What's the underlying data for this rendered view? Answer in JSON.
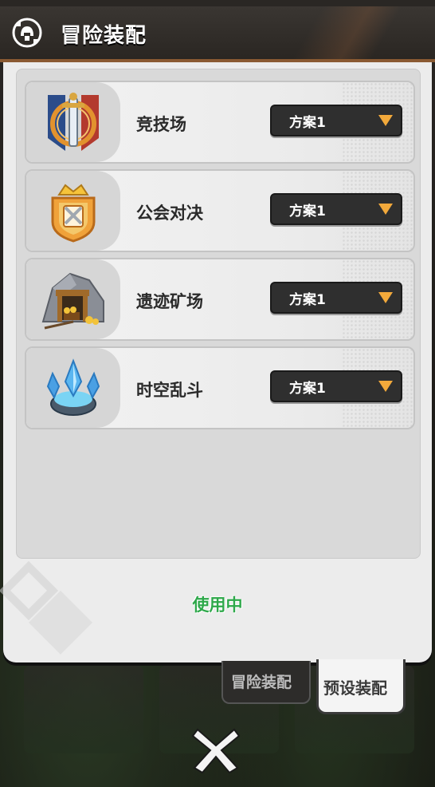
{
  "header": {
    "title": "冒险装配",
    "icon": "helmet-swap-icon"
  },
  "rows": [
    {
      "label": "竞技场",
      "dropdown": "方案1",
      "icon": "arena-sword-shield-icon"
    },
    {
      "label": "公会对决",
      "dropdown": "方案1",
      "icon": "guild-crown-badge-icon"
    },
    {
      "label": "遗迹矿场",
      "dropdown": "方案1",
      "icon": "mine-cave-gold-icon"
    },
    {
      "label": "时空乱斗",
      "dropdown": "方案1",
      "icon": "crystal-portal-icon"
    }
  ],
  "status": "使用中",
  "tabs": {
    "adventure": "冒险装配",
    "preset": "预设装配",
    "active": "preset"
  },
  "close": {
    "icon": "close-x-icon"
  },
  "colors": {
    "accent": "#f2a93b",
    "status": "#2ea84a",
    "header_border": "#8a5a32"
  }
}
